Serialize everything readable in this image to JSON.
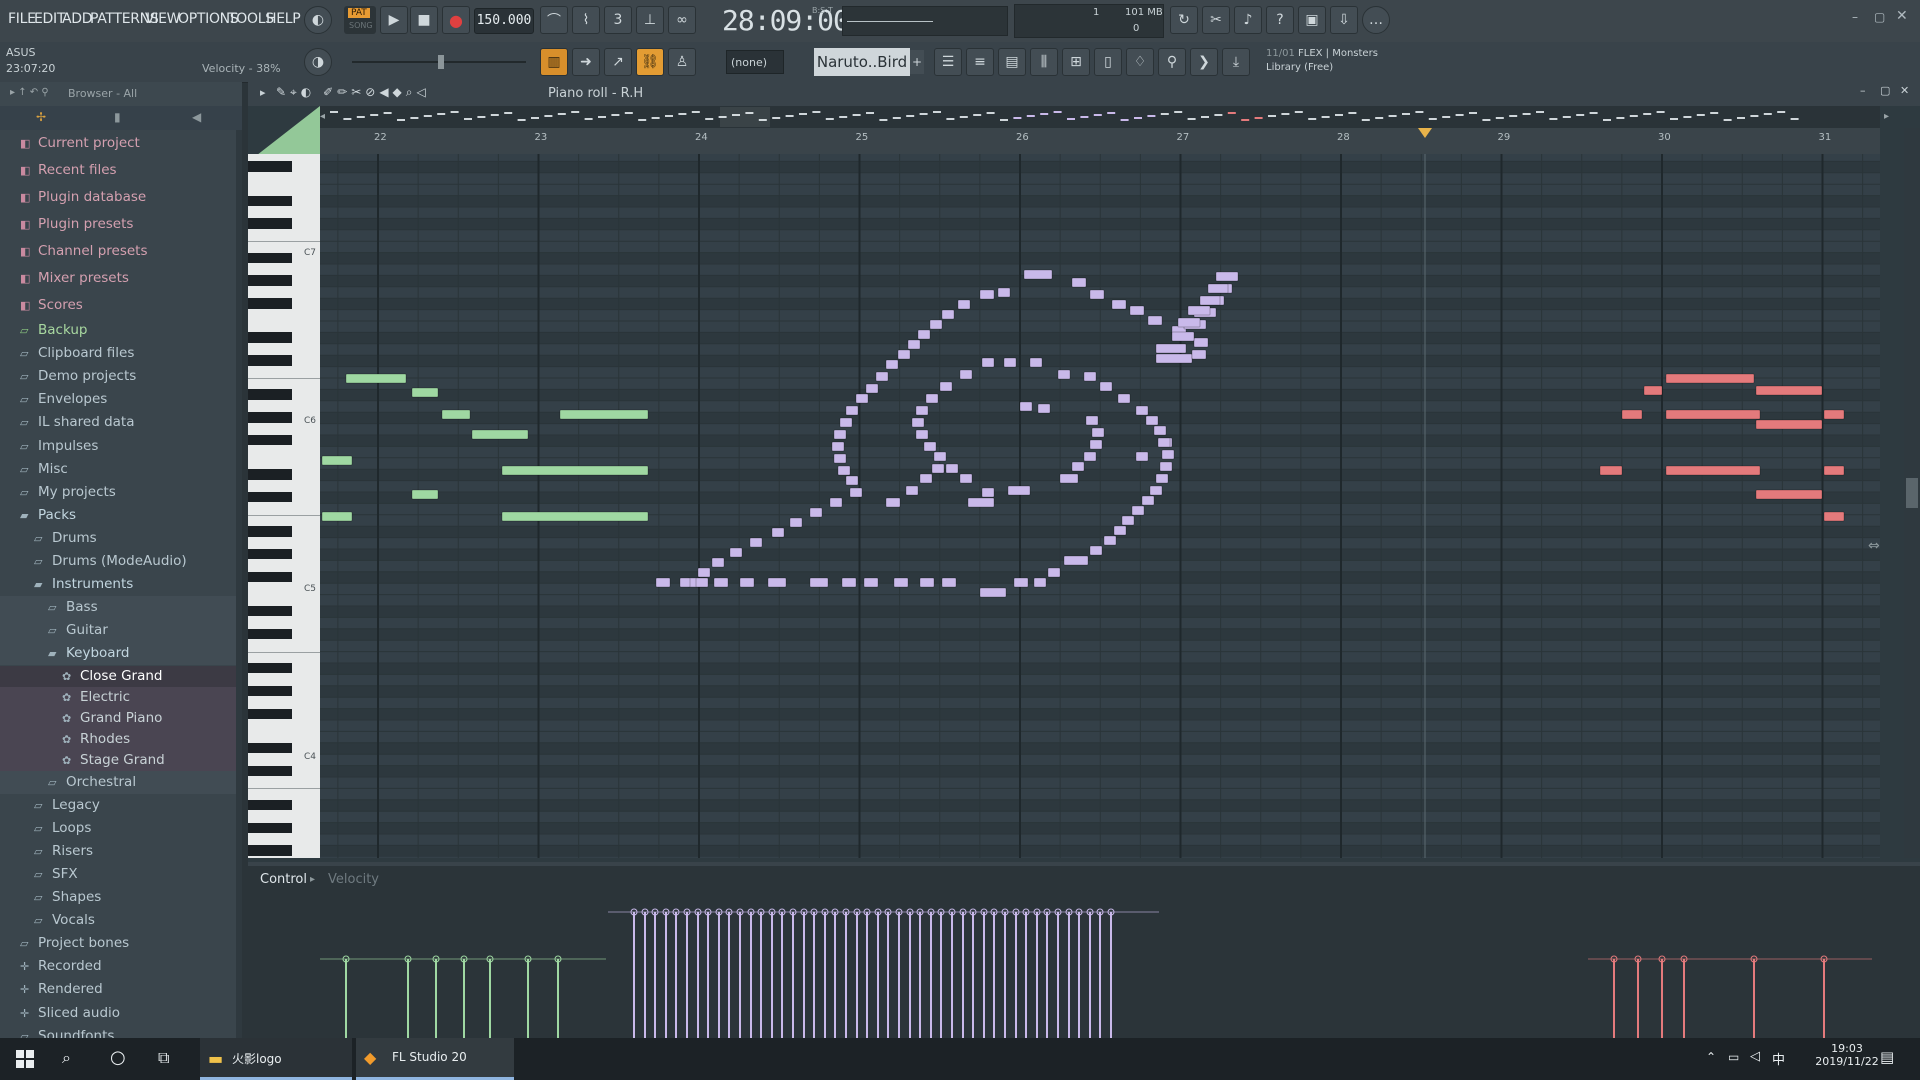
{
  "menu": [
    "FILE",
    "EDIT",
    "ADD",
    "PATTERNS",
    "VIEW",
    "OPTIONS",
    "TOOLS",
    "HELP"
  ],
  "transport": {
    "pat_label": "PAT",
    "song_label": "SONG",
    "tempo": "150.000",
    "time": "28:09:00",
    "time_caption": "B:S:T"
  },
  "monitor": {
    "memory": "101 MB",
    "cpu": "1",
    "poly": "0"
  },
  "hint": {
    "device": "ASUS",
    "clock": "23:07:20",
    "velocity": "Velocity - 38%"
  },
  "toolbar2": {
    "snap": "(none)",
    "pattern": "Naruto..Bird",
    "news_counter": "11/01",
    "news_line1": "FLEX | Monsters",
    "news_line2": "Library (Free)"
  },
  "browser": {
    "header": "Browser - All",
    "items": [
      {
        "label": "Current project",
        "kind": "special",
        "indent": 0
      },
      {
        "label": "Recent files",
        "kind": "special",
        "indent": 0
      },
      {
        "label": "Plugin database",
        "kind": "special",
        "indent": 0
      },
      {
        "label": "Plugin presets",
        "kind": "special",
        "indent": 0
      },
      {
        "label": "Channel presets",
        "kind": "special",
        "indent": 0
      },
      {
        "label": "Mixer presets",
        "kind": "special",
        "indent": 0
      },
      {
        "label": "Scores",
        "kind": "special",
        "indent": 0
      },
      {
        "label": "Backup",
        "kind": "green",
        "indent": 0
      },
      {
        "label": "Clipboard files",
        "kind": "folder",
        "indent": 0
      },
      {
        "label": "Demo projects",
        "kind": "folder",
        "indent": 0
      },
      {
        "label": "Envelopes",
        "kind": "folder",
        "indent": 0
      },
      {
        "label": "IL shared data",
        "kind": "folder",
        "indent": 0
      },
      {
        "label": "Impulses",
        "kind": "folder",
        "indent": 0
      },
      {
        "label": "Misc",
        "kind": "folder",
        "indent": 0
      },
      {
        "label": "My projects",
        "kind": "folder",
        "indent": 0
      },
      {
        "label": "Packs",
        "kind": "open",
        "indent": 0
      },
      {
        "label": "Drums",
        "kind": "folder",
        "indent": 1
      },
      {
        "label": "Drums (ModeAudio)",
        "kind": "folder",
        "indent": 1
      },
      {
        "label": "Instruments",
        "kind": "open",
        "indent": 1
      },
      {
        "label": "Bass",
        "kind": "folder",
        "indent": 2
      },
      {
        "label": "Guitar",
        "kind": "folder",
        "indent": 2
      },
      {
        "label": "Keyboard",
        "kind": "open",
        "indent": 2
      },
      {
        "label": "Close Grand",
        "kind": "preset-sel",
        "indent": 3
      },
      {
        "label": "Electric",
        "kind": "preset",
        "indent": 3
      },
      {
        "label": "Grand Piano",
        "kind": "preset",
        "indent": 3
      },
      {
        "label": "Rhodes",
        "kind": "preset",
        "indent": 3
      },
      {
        "label": "Stage Grand",
        "kind": "preset",
        "indent": 3
      },
      {
        "label": "Orchestral",
        "kind": "folder",
        "indent": 2
      },
      {
        "label": "Legacy",
        "kind": "folder",
        "indent": 1
      },
      {
        "label": "Loops",
        "kind": "folder",
        "indent": 1
      },
      {
        "label": "Risers",
        "kind": "folder",
        "indent": 1
      },
      {
        "label": "SFX",
        "kind": "folder",
        "indent": 1
      },
      {
        "label": "Shapes",
        "kind": "folder",
        "indent": 1
      },
      {
        "label": "Vocals",
        "kind": "folder",
        "indent": 1
      },
      {
        "label": "Project bones",
        "kind": "folder",
        "indent": 0
      },
      {
        "label": "Recorded",
        "kind": "plus",
        "indent": 0
      },
      {
        "label": "Rendered",
        "kind": "plus",
        "indent": 0
      },
      {
        "label": "Sliced audio",
        "kind": "plus",
        "indent": 0
      },
      {
        "label": "Soundfonts",
        "kind": "folder",
        "indent": 0
      }
    ]
  },
  "pianoroll": {
    "title": "Piano roll - R.H",
    "bars": [
      "22",
      "23",
      "24",
      "25",
      "26",
      "27",
      "28",
      "29",
      "30",
      "31"
    ],
    "octave_labels": [
      "C7",
      "C6",
      "C5",
      "C4"
    ],
    "control_label": "Control",
    "control_target": "Velocity",
    "colors": {
      "green": "#9fd8a2",
      "purple": "#c9b9ea",
      "red": "#e47a7c",
      "grid": "#344048",
      "bar_line": "#1f282c"
    }
  },
  "taskbar": {
    "folder": "火影logo",
    "app": "FL Studio 20",
    "time": "19:03",
    "date": "2019/11/22",
    "ime": "中"
  }
}
